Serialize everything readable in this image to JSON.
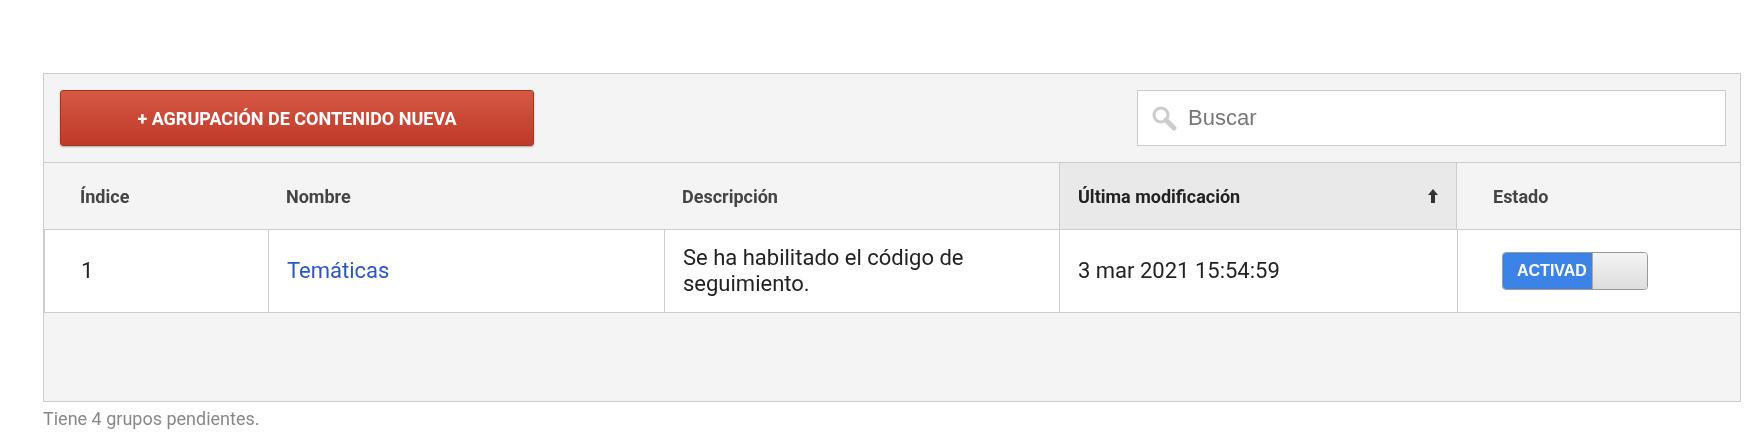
{
  "toolbar": {
    "new_button": "+ AGRUPACIÓN DE CONTENIDO NUEVA",
    "search": {
      "placeholder": "Buscar"
    }
  },
  "table": {
    "columns": [
      {
        "label": "Índice",
        "sorted": false
      },
      {
        "label": "Nombre",
        "sorted": false
      },
      {
        "label": "Descripción",
        "sorted": false
      },
      {
        "label": "Última modificación",
        "sorted": true
      },
      {
        "label": "Estado",
        "sorted": false
      }
    ],
    "rows": [
      {
        "index": "1",
        "name": "Temáticas",
        "description": "Se ha habilitado el código de seguimiento.",
        "modified": "3 mar 2021 15:54:59",
        "status": {
          "label": "ACTIVAD",
          "on": true
        }
      }
    ]
  },
  "footer": "Tiene 4 grupos pendientes."
}
